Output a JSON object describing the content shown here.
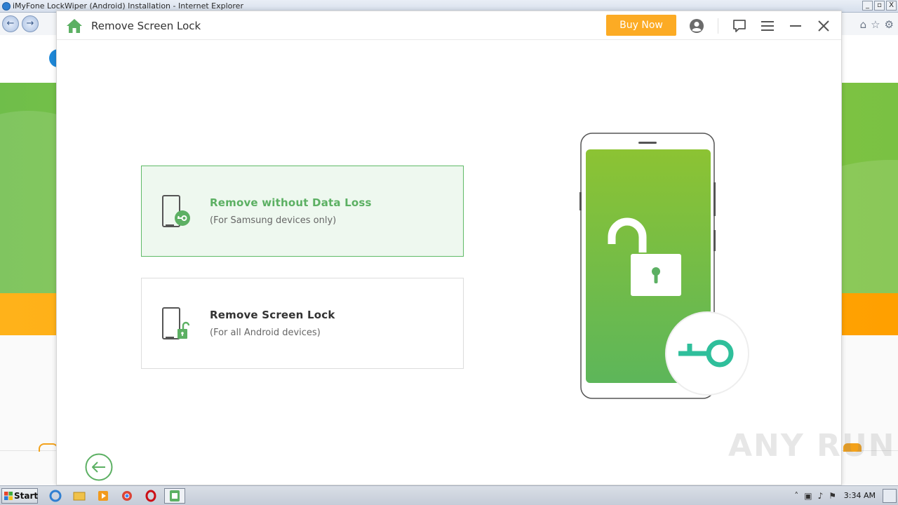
{
  "browser": {
    "title": "iMyFone LockWiper (Android) Installation - Internet Explorer",
    "window_buttons": [
      "_",
      "▫",
      "X"
    ]
  },
  "app": {
    "header": {
      "title": "Remove Screen Lock",
      "buy_label": "Buy Now"
    },
    "options": [
      {
        "title": "Remove without Data Loss",
        "subtitle": "(For Samsung devices only)",
        "selected": true
      },
      {
        "title": "Remove Screen Lock",
        "subtitle": "(For all Android devices)",
        "selected": false
      }
    ],
    "colors": {
      "brand_green": "#5cb063",
      "buy_orange": "#fcab24",
      "key_teal": "#2fbf9b"
    }
  },
  "watermark": "ANY RUN",
  "taskbar": {
    "start_label": "Start",
    "clock": "3:34 AM"
  }
}
